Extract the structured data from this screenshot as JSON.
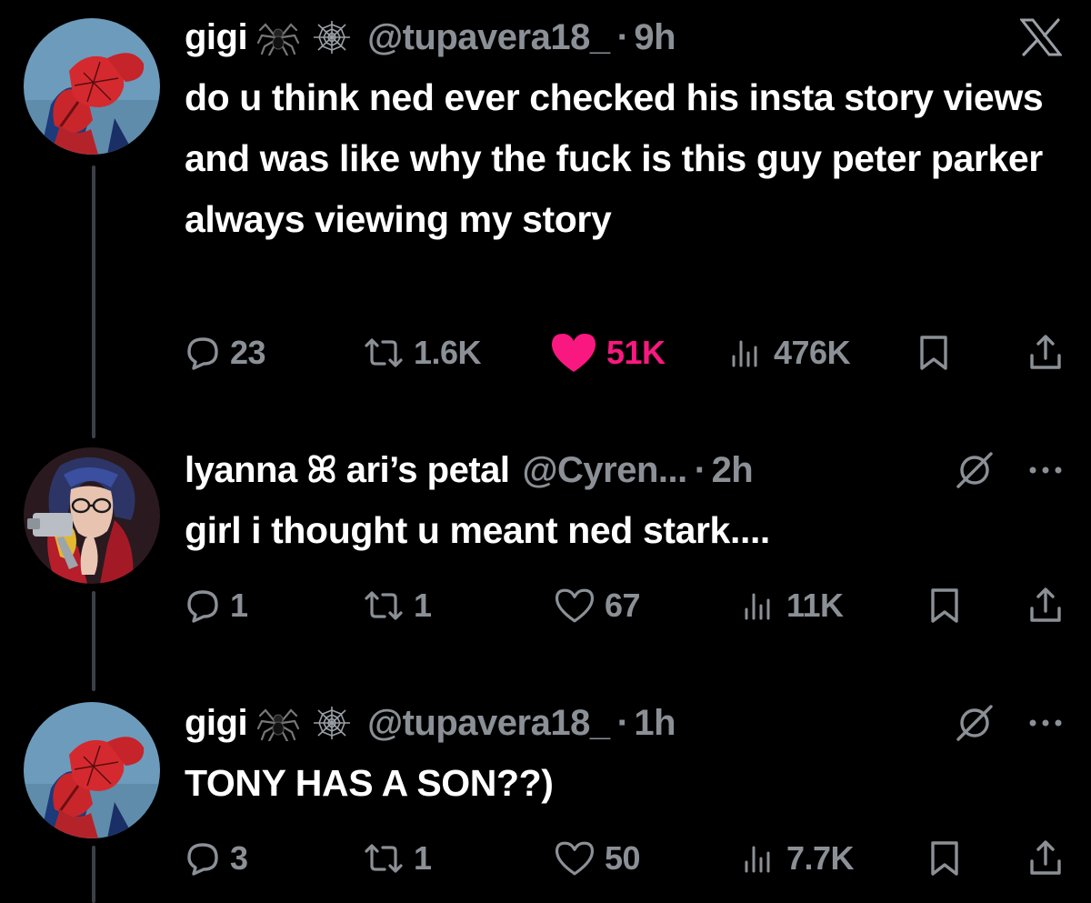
{
  "x_logo": "X",
  "colors": {
    "background": "#000000",
    "text": "#ffffff",
    "muted": "#8b9096",
    "like_active": "#f91880",
    "thread_line": "#3b4046"
  },
  "tweets": [
    {
      "author": "gigi",
      "handle": "@tupavera18_",
      "separator": "·",
      "time": "9h",
      "badges": [
        "spider-emoji",
        "spider-web-emoji"
      ],
      "text": "do u think ned ever checked his insta story views and was like why the fuck is this guy peter parker always viewing my story",
      "replies": "23",
      "reposts": "1.6K",
      "likes": "51K",
      "views": "476K",
      "liked": true
    },
    {
      "author": "lyanna ꕤ ari’s petal",
      "handle": "@Cyren...",
      "separator": "·",
      "time": "2h",
      "text": "girl i thought u meant ned stark....",
      "replies": "1",
      "reposts": "1",
      "likes": "67",
      "views": "11K",
      "liked": false
    },
    {
      "author": "gigi",
      "handle": "@tupavera18_",
      "separator": "·",
      "time": "1h",
      "badges": [
        "spider-emoji",
        "spider-web-emoji"
      ],
      "text": "TONY HAS A SON??)",
      "replies": "3",
      "reposts": "1",
      "likes": "50",
      "views": "7.7K",
      "liked": false
    }
  ]
}
